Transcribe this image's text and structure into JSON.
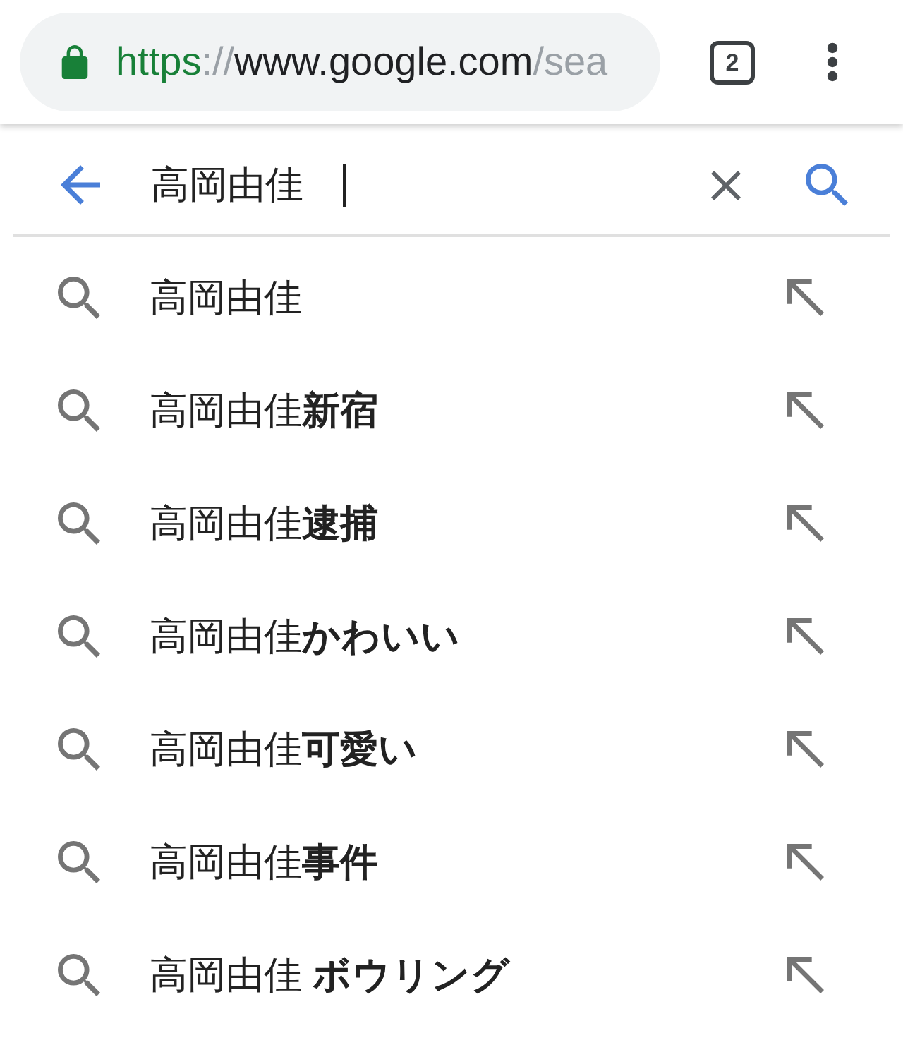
{
  "toolbar": {
    "secure": true,
    "url": {
      "scheme": "https",
      "separator": "://",
      "host": "www.google.com",
      "path": "/sea"
    },
    "tab_count": "2"
  },
  "search": {
    "value": "高岡由佳",
    "focused": true
  },
  "suggestions": [
    {
      "text": "高岡由佳"
    },
    {
      "text": "高岡由佳**新宿**"
    },
    {
      "text": "高岡由佳**逮捕**"
    },
    {
      "text": "高岡由佳**かわいい**"
    },
    {
      "text": "高岡由佳**可愛い**"
    },
    {
      "text": "高岡由佳**事件**"
    },
    {
      "text": "高岡由佳 **ボウリング**"
    }
  ]
}
